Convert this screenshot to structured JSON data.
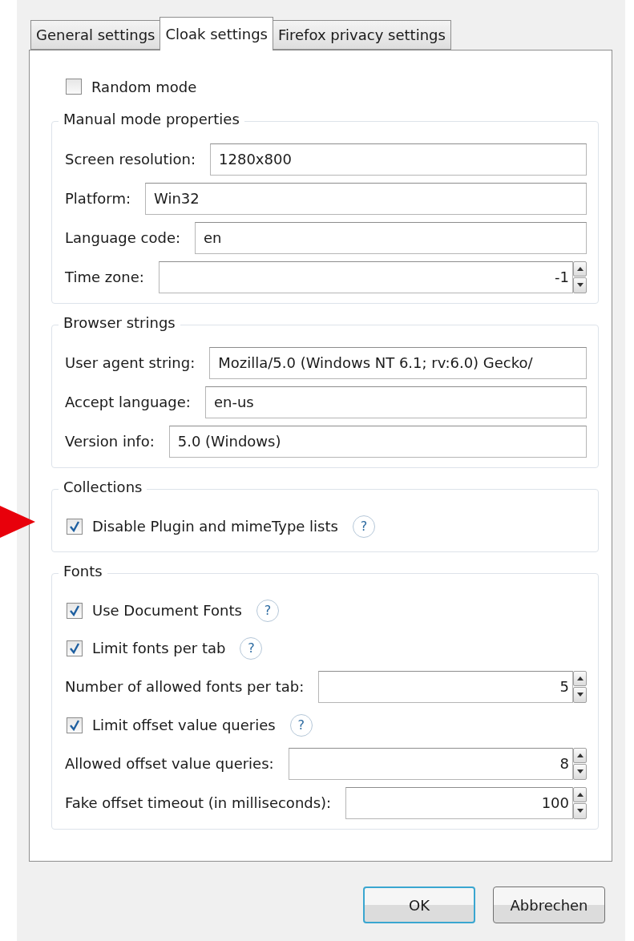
{
  "tabs": [
    {
      "label": "General settings",
      "selected": false
    },
    {
      "label": "Cloak settings",
      "selected": true
    },
    {
      "label": "Firefox privacy settings",
      "selected": false
    }
  ],
  "random_mode": {
    "label": "Random mode",
    "checked": false
  },
  "groups": [
    {
      "title": "Manual mode properties",
      "rows": [
        {
          "kind": "text",
          "label": "Screen resolution:",
          "value": "1280x800"
        },
        {
          "kind": "text",
          "label": "Platform:",
          "value": "Win32"
        },
        {
          "kind": "text",
          "label": "Language code:",
          "value": "en"
        },
        {
          "kind": "spin",
          "label": "Time zone:",
          "value": "-1"
        }
      ]
    },
    {
      "title": "Browser strings",
      "rows": [
        {
          "kind": "text",
          "label": "User agent string:",
          "value": "Mozilla/5.0 (Windows NT 6.1; rv:6.0) Gecko/"
        },
        {
          "kind": "text",
          "label": "Accept language:",
          "value": "en-us"
        },
        {
          "kind": "text",
          "label": "Version info:",
          "value": "5.0 (Windows)"
        }
      ]
    },
    {
      "title": "Collections",
      "rows": [
        {
          "kind": "check",
          "label": "Disable Plugin and mimeType lists",
          "checked": true,
          "help": "?"
        }
      ]
    },
    {
      "title": "Fonts",
      "rows": [
        {
          "kind": "check",
          "label": "Use Document Fonts",
          "checked": true,
          "help": "?"
        },
        {
          "kind": "check",
          "label": "Limit fonts per tab",
          "checked": true,
          "help": "?"
        },
        {
          "kind": "spin",
          "label": "Number of allowed fonts per tab:",
          "value": "5"
        },
        {
          "kind": "check",
          "label": "Limit offset value queries",
          "checked": true,
          "help": "?"
        },
        {
          "kind": "spin",
          "label": "Allowed offset value queries:",
          "value": "8"
        },
        {
          "kind": "spin",
          "label": "Fake offset timeout (in milliseconds):",
          "value": "100"
        }
      ]
    }
  ],
  "buttons": [
    {
      "label": "OK",
      "default": true
    },
    {
      "label": "Abbrechen",
      "default": false
    }
  ]
}
